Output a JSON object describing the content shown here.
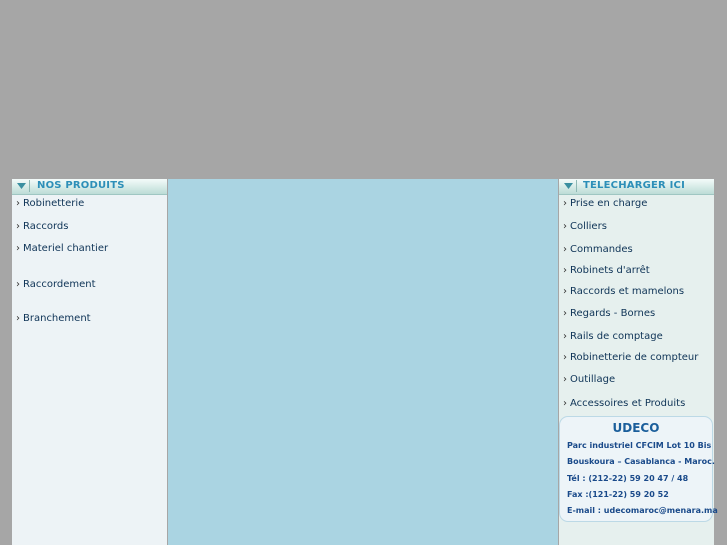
{
  "left_panel": {
    "title": "NOS PRODUITS",
    "bullet": "›",
    "items": [
      "Robinetterie",
      "Raccords",
      "Materiel chantier",
      "Raccordement",
      "Branchement"
    ]
  },
  "right_panel": {
    "title": "TELECHARGER ICI",
    "bullet": "›",
    "items": [
      "Prise en charge",
      "Colliers",
      "Commandes",
      "Robinets d'arrêt",
      "Raccords et mamelons",
      "Regards - Bornes",
      "Rails de comptage",
      "Robinetterie de compteur",
      "Outillage",
      "Accessoires et Produits"
    ]
  },
  "contact": {
    "company": "UDECO",
    "address_1": "Parc industriel CFCIM Lot 10 Bis",
    "address_2": "Bouskoura – Casablanca - Maroc.",
    "phone": "Tél : (212-22) 59 20 47 / 48",
    "fax": "Fax :(121-22) 59 20 52",
    "email": "E-mail : udecomaroc@menara.ma"
  },
  "colors": {
    "page_background": "#a6a6a6",
    "center_panel": "#aad4e2",
    "header_title": "#2d8fb8",
    "link_text": "#0e3356"
  },
  "icons": {
    "header_toggle": "triangle-down-icon"
  }
}
